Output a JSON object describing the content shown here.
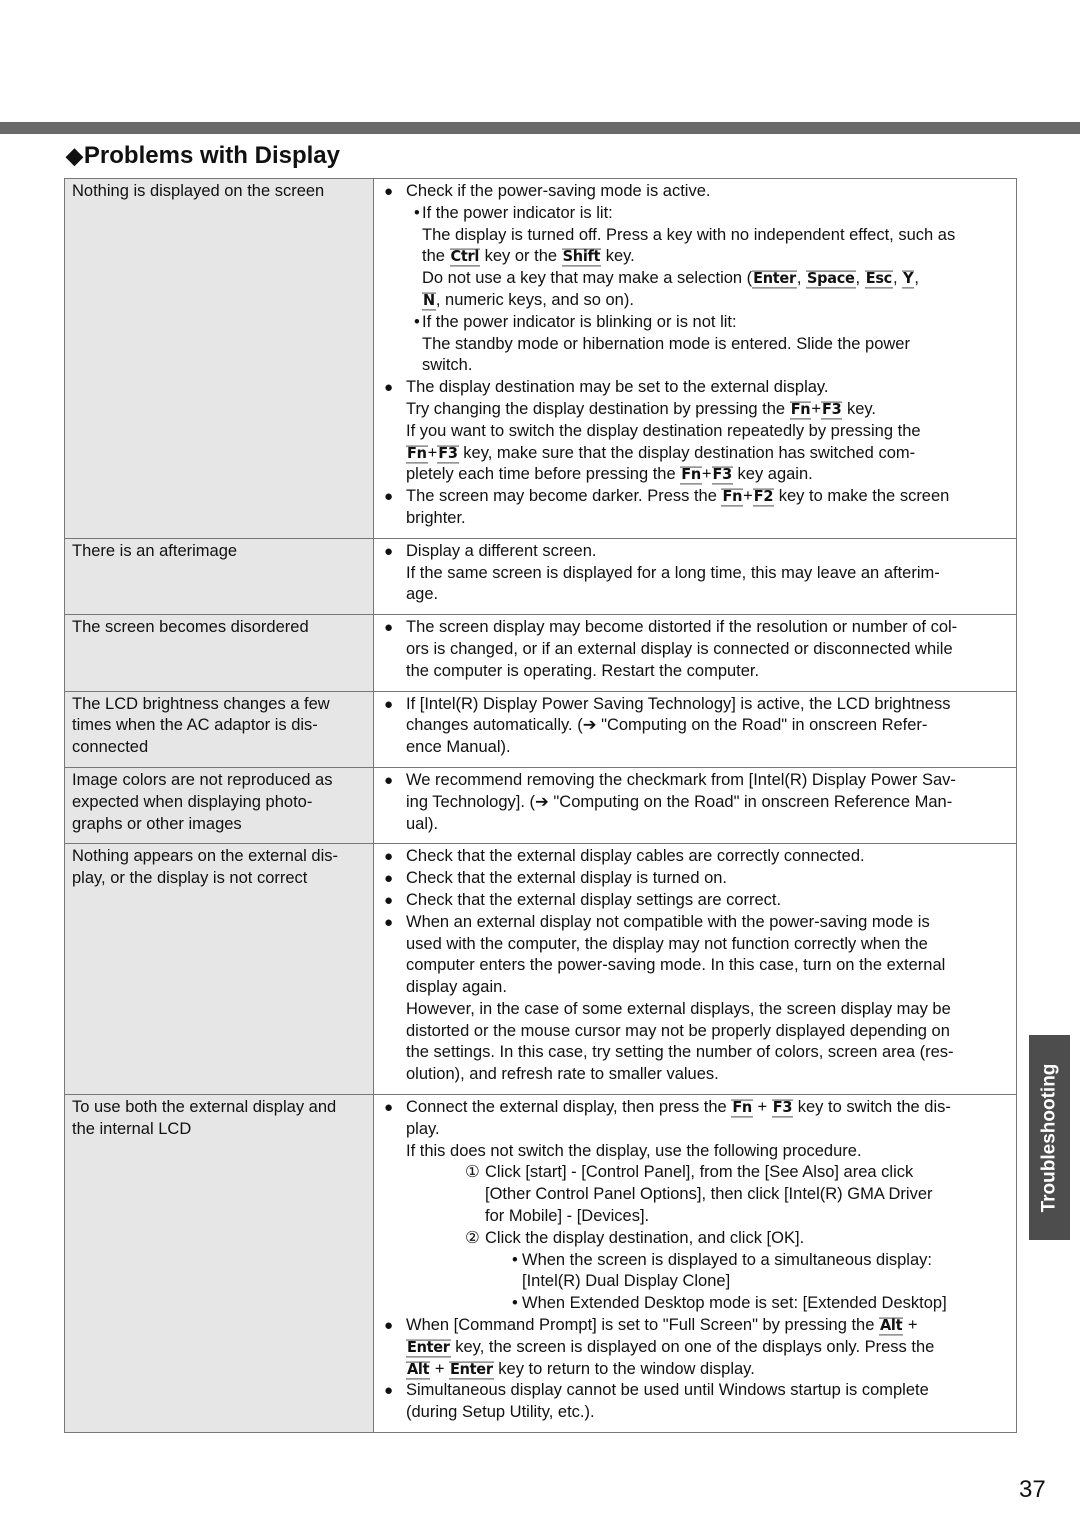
{
  "section": {
    "title": "Problems with Display",
    "marker_icon": "diamond-bullet"
  },
  "side_tab": "Troubleshooting",
  "page_number": "37",
  "rows": [
    {
      "symptom": [
        "Nothing is displayed on the screen"
      ],
      "lines": [
        {
          "cls": "l0",
          "mark": "bullet",
          "segs": [
            [
              "t",
              "Check if the power-saving mode is active."
            ]
          ]
        },
        {
          "cls": "l1b",
          "mark": "dot",
          "segs": [
            [
              "t",
              "If the power indicator is lit:"
            ]
          ]
        },
        {
          "cls": "l1b",
          "segs": [
            [
              "t",
              "The display is turned off. Press a key with no independent effect, such as"
            ]
          ]
        },
        {
          "cls": "l1b",
          "segs": [
            [
              "t",
              "the "
            ],
            [
              "k",
              "Ctrl"
            ],
            [
              "t",
              " key or the "
            ],
            [
              "k",
              "Shift"
            ],
            [
              "t",
              " key."
            ]
          ]
        },
        {
          "cls": "l1b",
          "segs": [
            [
              "t",
              "Do not use a key that may make a selection ("
            ],
            [
              "k",
              "Enter"
            ],
            [
              "t",
              ", "
            ],
            [
              "k",
              "Space"
            ],
            [
              "t",
              ", "
            ],
            [
              "k",
              "Esc"
            ],
            [
              "t",
              ", "
            ],
            [
              "k",
              "Y"
            ],
            [
              "t",
              ","
            ]
          ]
        },
        {
          "cls": "l1b",
          "segs": [
            [
              "k",
              "N"
            ],
            [
              "t",
              ", numeric keys, and so on)."
            ]
          ]
        },
        {
          "cls": "l1b",
          "mark": "dot",
          "segs": [
            [
              "t",
              "If the power indicator is blinking or is not lit:"
            ]
          ]
        },
        {
          "cls": "l1b",
          "segs": [
            [
              "t",
              "The standby mode or hibernation mode is entered. Slide the power"
            ]
          ]
        },
        {
          "cls": "l1b",
          "segs": [
            [
              "t",
              "switch."
            ]
          ]
        },
        {
          "cls": "l0",
          "mark": "bullet",
          "segs": [
            [
              "t",
              "The display destination may be set to the external display."
            ]
          ]
        },
        {
          "cls": "l0",
          "segs": [
            [
              "t",
              "Try changing the display destination by pressing the "
            ],
            [
              "k",
              "Fn"
            ],
            [
              "t",
              "+"
            ],
            [
              "k",
              "F3"
            ],
            [
              "t",
              " key."
            ]
          ]
        },
        {
          "cls": "l0",
          "segs": [
            [
              "t",
              "If you want to switch the display destination repeatedly by pressing the"
            ]
          ]
        },
        {
          "cls": "l0",
          "segs": [
            [
              "k",
              "Fn"
            ],
            [
              "t",
              "+"
            ],
            [
              "k",
              "F3"
            ],
            [
              "t",
              " key, make sure that the display destination has switched com-"
            ]
          ]
        },
        {
          "cls": "l0",
          "segs": [
            [
              "t",
              "pletely each time before pressing the "
            ],
            [
              "k",
              "Fn"
            ],
            [
              "t",
              "+"
            ],
            [
              "k",
              "F3"
            ],
            [
              "t",
              " key again."
            ]
          ]
        },
        {
          "cls": "l0",
          "mark": "bullet",
          "segs": [
            [
              "t",
              "The screen may become darker. Press the "
            ],
            [
              "k",
              "Fn"
            ],
            [
              "t",
              "+"
            ],
            [
              "k",
              "F2"
            ],
            [
              "t",
              " key to make the screen"
            ]
          ]
        },
        {
          "cls": "l0",
          "segs": [
            [
              "t",
              "brighter."
            ]
          ]
        }
      ]
    },
    {
      "symptom": [
        "There is an afterimage"
      ],
      "lines": [
        {
          "cls": "l0",
          "mark": "bullet",
          "segs": [
            [
              "t",
              "Display a different screen."
            ]
          ]
        },
        {
          "cls": "l0",
          "segs": [
            [
              "t",
              "If the same screen is displayed for a long time, this may leave an afterim-"
            ]
          ]
        },
        {
          "cls": "l0",
          "segs": [
            [
              "t",
              "age."
            ]
          ]
        }
      ]
    },
    {
      "symptom": [
        "The screen becomes disordered"
      ],
      "lines": [
        {
          "cls": "l0",
          "mark": "bullet",
          "segs": [
            [
              "t",
              "The screen display may become distorted if the resolution or number of col-"
            ]
          ]
        },
        {
          "cls": "l0",
          "segs": [
            [
              "t",
              "ors is changed, or if an external display is connected or disconnected while"
            ]
          ]
        },
        {
          "cls": "l0",
          "segs": [
            [
              "t",
              "the computer is operating. Restart the computer."
            ]
          ]
        }
      ]
    },
    {
      "symptom": [
        "The LCD brightness changes a few",
        "times when the AC adaptor is dis-",
        "connected"
      ],
      "lines": [
        {
          "cls": "l0",
          "mark": "bullet",
          "segs": [
            [
              "t",
              "If [Intel(R) Display Power Saving Technology] is active, the LCD brightness"
            ]
          ]
        },
        {
          "cls": "l0",
          "segs": [
            [
              "t",
              "changes automatically. (➔ \"Computing on the Road\" in onscreen Refer-"
            ]
          ]
        },
        {
          "cls": "l0",
          "segs": [
            [
              "t",
              "ence Manual)."
            ]
          ]
        }
      ]
    },
    {
      "symptom": [
        "Image colors are not reproduced as",
        "expected when displaying photo-",
        "graphs or other images"
      ],
      "lines": [
        {
          "cls": "l0",
          "mark": "bullet",
          "segs": [
            [
              "t",
              "We recommend removing the checkmark from [Intel(R) Display Power Sav-"
            ]
          ]
        },
        {
          "cls": "l0",
          "segs": [
            [
              "t",
              "ing Technology]. (➔ \"Computing on the Road\" in onscreen Reference Man-"
            ]
          ]
        },
        {
          "cls": "l0",
          "segs": [
            [
              "t",
              "ual)."
            ]
          ]
        }
      ]
    },
    {
      "symptom": [
        "Nothing appears on the external dis-",
        "play, or the display is not correct"
      ],
      "lines": [
        {
          "cls": "l0",
          "mark": "bullet",
          "segs": [
            [
              "t",
              "Check that the external display cables are correctly connected."
            ]
          ]
        },
        {
          "cls": "l0",
          "mark": "bullet",
          "segs": [
            [
              "t",
              "Check that the external display is turned on."
            ]
          ]
        },
        {
          "cls": "l0",
          "mark": "bullet",
          "segs": [
            [
              "t",
              "Check that the external display settings are correct."
            ]
          ]
        },
        {
          "cls": "l0",
          "mark": "bullet",
          "segs": [
            [
              "t",
              "When an external display not compatible with the power-saving mode is"
            ]
          ]
        },
        {
          "cls": "l0",
          "segs": [
            [
              "t",
              "used with the computer, the display may not function correctly when the"
            ]
          ]
        },
        {
          "cls": "l0",
          "segs": [
            [
              "t",
              "computer enters the power-saving mode. In this case, turn on the external"
            ]
          ]
        },
        {
          "cls": "l0",
          "segs": [
            [
              "t",
              "display again."
            ]
          ]
        },
        {
          "cls": "l0",
          "segs": [
            [
              "t",
              "However, in the case of some external displays, the screen display may be"
            ]
          ]
        },
        {
          "cls": "l0",
          "segs": [
            [
              "t",
              "distorted or the mouse cursor may not be properly displayed depending on"
            ]
          ]
        },
        {
          "cls": "l0",
          "segs": [
            [
              "t",
              "the settings.  In this case, try setting the number of colors, screen area (res-"
            ]
          ]
        },
        {
          "cls": "l0",
          "segs": [
            [
              "t",
              "olution), and refresh rate to smaller values."
            ]
          ]
        }
      ]
    },
    {
      "symptom": [
        "To use both the external display and",
        "the internal LCD"
      ],
      "lines": [
        {
          "cls": "l0",
          "mark": "bullet",
          "segs": [
            [
              "t",
              "Connect the external display, then press the "
            ],
            [
              "k",
              "Fn"
            ],
            [
              "t",
              " + "
            ],
            [
              "k",
              "F3"
            ],
            [
              "t",
              " key to switch the dis-"
            ]
          ]
        },
        {
          "cls": "l0",
          "segs": [
            [
              "t",
              "play."
            ]
          ]
        },
        {
          "cls": "l0",
          "segs": [
            [
              "t",
              "If this does not switch the display, use the following procedure."
            ]
          ]
        },
        {
          "cls": "l2b",
          "mark": "num",
          "num": "①",
          "segs": [
            [
              "t",
              "Click [start] - [Control Panel], from the [See Also] area click"
            ]
          ]
        },
        {
          "cls": "l2b",
          "segs": [
            [
              "t",
              "[Other Control Panel Options], then click [Intel(R) GMA Driver"
            ]
          ]
        },
        {
          "cls": "l2b",
          "segs": [
            [
              "t",
              "for Mobile] - [Devices]."
            ]
          ]
        },
        {
          "cls": "l2b",
          "mark": "num",
          "num": "②",
          "segs": [
            [
              "t",
              "Click the display destination, and click [OK]."
            ]
          ]
        },
        {
          "cls": "l3b",
          "mark": "dot3",
          "segs": [
            [
              "t",
              "When the screen is displayed to a simultaneous display:"
            ]
          ]
        },
        {
          "cls": "l3b",
          "segs": [
            [
              "t",
              "[Intel(R) Dual Display Clone]"
            ]
          ]
        },
        {
          "cls": "l3b",
          "mark": "dot3",
          "segs": [
            [
              "t",
              "When Extended Desktop mode is set: [Extended Desktop]"
            ]
          ]
        },
        {
          "cls": "l0",
          "mark": "bullet",
          "segs": [
            [
              "t",
              "When [Command Prompt] is set to \"Full Screen\" by pressing the "
            ],
            [
              "k",
              "Alt"
            ],
            [
              "t",
              " +"
            ]
          ]
        },
        {
          "cls": "l0",
          "segs": [
            [
              "k",
              "Enter"
            ],
            [
              "t",
              " key, the screen is displayed on one of the displays only. Press the"
            ]
          ]
        },
        {
          "cls": "l0",
          "segs": [
            [
              "k",
              "Alt"
            ],
            [
              "t",
              " + "
            ],
            [
              "k",
              "Enter"
            ],
            [
              "t",
              " key to return to the window display."
            ]
          ]
        },
        {
          "cls": "l0",
          "mark": "bullet",
          "segs": [
            [
              "t",
              "Simultaneous display cannot be used until Windows startup is complete"
            ]
          ]
        },
        {
          "cls": "l0",
          "segs": [
            [
              "t",
              "(during Setup Utility, etc.)."
            ]
          ]
        }
      ]
    }
  ]
}
